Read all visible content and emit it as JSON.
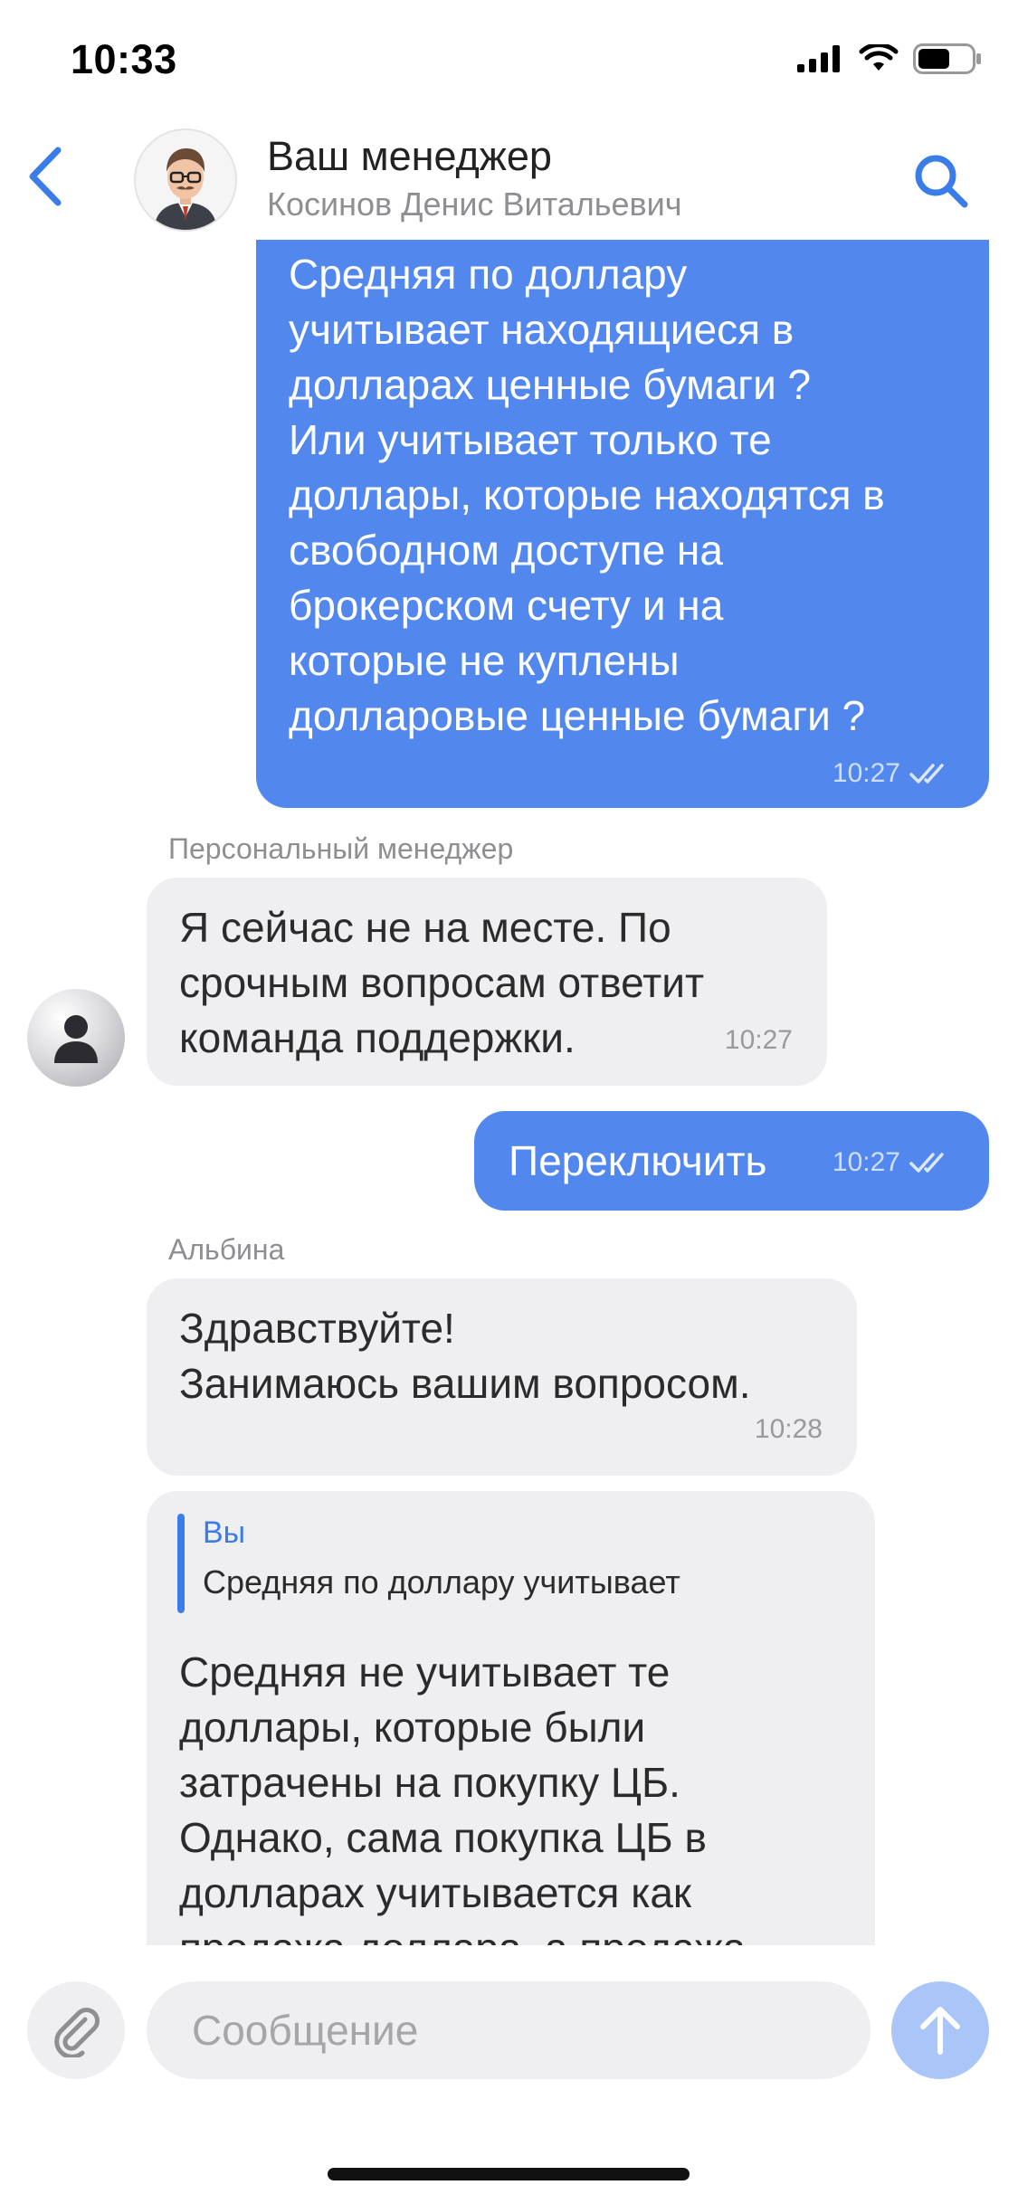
{
  "status_bar": {
    "time": "10:33"
  },
  "header": {
    "title": "Ваш менеджер",
    "subtitle": "Косинов Денис Витальевич"
  },
  "messages": [
    {
      "direction": "outgoing",
      "text": "Средняя по доллару\nучитывает находящиеся в\nдолларах ценные бумаги ?\nИли учитывает только те\nдоллары, которые находятся в\nсвободном доступе на\nброкерском счету и на\nкоторые не куплены\nдолларовые ценные бумаги ?",
      "time": "10:27",
      "status": "read"
    },
    {
      "direction": "incoming",
      "sender": "Персональный менеджер",
      "text": "Я сейчас не на месте. По\nсрочным вопросам ответит\nкоманда поддержки.",
      "time": "10:27"
    },
    {
      "direction": "outgoing",
      "text": "Переключить",
      "time": "10:27",
      "status": "read"
    },
    {
      "direction": "incoming",
      "sender": "Альбина",
      "text": "Здравствуйте!\nЗанимаюсь вашим вопросом.",
      "time": "10:28"
    },
    {
      "direction": "incoming",
      "reply_to": {
        "author": "Вы",
        "preview": "Средняя по доллару учитывает"
      },
      "text": "Средняя не учитывает те\nдоллары, которые были\nзатрачены на покупку ЦБ.\nОднако, сама покупка ЦБ в\nдолларах учитывается как\nпродажа доллара, а продажа"
    }
  ],
  "composer": {
    "placeholder": "Сообщение"
  },
  "colors": {
    "accent": "#3a7ce8",
    "outgoing_bubble": "#5288ee",
    "incoming_bubble": "#efeff1",
    "send_button_disabled": "#aac5f7"
  },
  "icons": {
    "back": "chevron-left-icon",
    "search": "search-icon",
    "attach": "paperclip-icon",
    "send": "arrow-up-icon",
    "read": "double-check-icon",
    "avatar_placeholder": "person-icon"
  }
}
